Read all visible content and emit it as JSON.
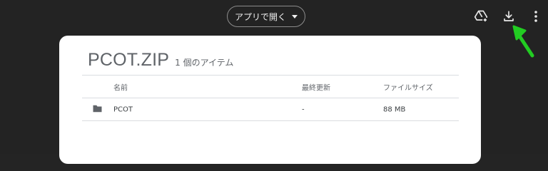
{
  "toolbar": {
    "open_with_label": "アプリで開く",
    "icons": [
      "add-to-drive-icon",
      "download-icon",
      "more-vert-icon"
    ]
  },
  "annotation": {
    "arrow_color": "#22cc22"
  },
  "archive": {
    "title": "PCOT.ZIP",
    "item_count": "1 個のアイテム",
    "columns": {
      "name": "名前",
      "modified": "最終更新",
      "size": "ファイルサイズ"
    },
    "rows": [
      {
        "icon": "folder-icon",
        "name": "PCOT",
        "modified": "-",
        "size": "88 MB"
      }
    ]
  },
  "colors": {
    "background": "#232323",
    "card": "#ffffff",
    "text_muted": "#5f6368"
  }
}
